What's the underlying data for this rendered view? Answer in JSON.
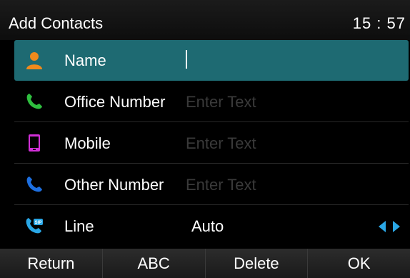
{
  "header": {
    "title": "Add Contacts",
    "time": "15 : 57"
  },
  "fields": [
    {
      "label": "Name",
      "icon": "person-icon",
      "value": "",
      "placeholder": ""
    },
    {
      "label": "Office Number",
      "icon": "office-phone-icon",
      "placeholder": "Enter Text"
    },
    {
      "label": "Mobile",
      "icon": "mobile-phone-icon",
      "placeholder": "Enter Text"
    },
    {
      "label": "Other Number",
      "icon": "other-phone-icon",
      "placeholder": "Enter Text"
    },
    {
      "label": "Line",
      "icon": "sip-line-icon",
      "value": "Auto"
    }
  ],
  "softkeys": [
    "Return",
    "ABC",
    "Delete",
    "OK"
  ],
  "colors": {
    "selected_row": "#1e6a72",
    "person_icon": "#f08a1c",
    "office_phone_icon": "#2fbf3f",
    "mobile_icon": "#d02fd6",
    "other_phone_icon": "#1d6fe0",
    "sip_icon": "#2aa7e6"
  }
}
